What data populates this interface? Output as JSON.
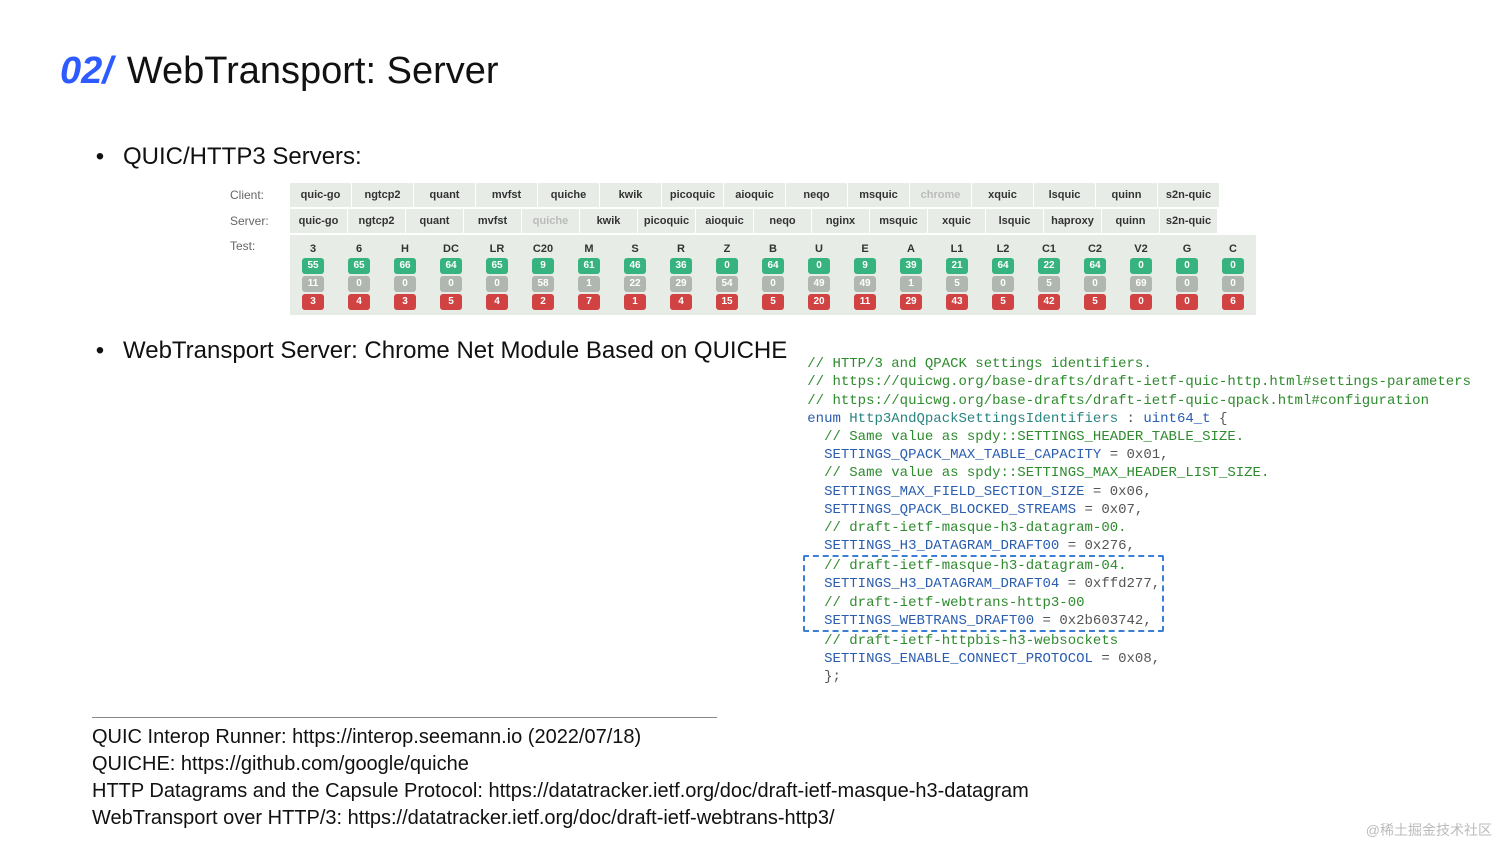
{
  "header": {
    "section_no": "02/",
    "title": "WebTransport: Server"
  },
  "bullet1": "QUIC/HTTP3 Servers:",
  "bullet2": "WebTransport Server: Chrome Net Module Based on QUICHE",
  "interop": {
    "client_label": "Client:",
    "server_label": "Server:",
    "test_label": "Test:",
    "clients": [
      "quic-go",
      "ngtcp2",
      "quant",
      "mvfst",
      "quiche",
      "kwik",
      "picoquic",
      "aioquic",
      "neqo",
      "msquic",
      "chrome",
      "xquic",
      "lsquic",
      "quinn",
      "s2n-quic"
    ],
    "client_dim_index": 10,
    "servers": [
      "quic-go",
      "ngtcp2",
      "quant",
      "mvfst",
      "quiche",
      "kwik",
      "picoquic",
      "aioquic",
      "neqo",
      "nginx",
      "msquic",
      "xquic",
      "lsquic",
      "haproxy",
      "quinn",
      "s2n-quic"
    ],
    "server_dim_index": 4,
    "test_cols": [
      {
        "h": "3",
        "g": "55",
        "m": "11",
        "r": "3"
      },
      {
        "h": "6",
        "g": "65",
        "m": "0",
        "r": "4"
      },
      {
        "h": "H",
        "g": "66",
        "m": "0",
        "r": "3"
      },
      {
        "h": "DC",
        "g": "64",
        "m": "0",
        "r": "5"
      },
      {
        "h": "LR",
        "g": "65",
        "m": "0",
        "r": "4"
      },
      {
        "h": "C20",
        "g": "9",
        "m": "58",
        "r": "2"
      },
      {
        "h": "M",
        "g": "61",
        "m": "1",
        "r": "7"
      },
      {
        "h": "S",
        "g": "46",
        "m": "22",
        "r": "1"
      },
      {
        "h": "R",
        "g": "36",
        "m": "29",
        "r": "4"
      },
      {
        "h": "Z",
        "g": "0",
        "m": "54",
        "r": "15"
      },
      {
        "h": "B",
        "g": "64",
        "m": "0",
        "r": "5"
      },
      {
        "h": "U",
        "g": "0",
        "m": "49",
        "r": "20"
      },
      {
        "h": "E",
        "g": "9",
        "m": "49",
        "r": "11"
      },
      {
        "h": "A",
        "g": "39",
        "m": "1",
        "r": "29"
      },
      {
        "h": "L1",
        "g": "21",
        "m": "5",
        "r": "43"
      },
      {
        "h": "L2",
        "g": "64",
        "m": "0",
        "r": "5"
      },
      {
        "h": "C1",
        "g": "22",
        "m": "5",
        "r": "42"
      },
      {
        "h": "C2",
        "g": "64",
        "m": "0",
        "r": "5"
      },
      {
        "h": "V2",
        "g": "0",
        "m": "69",
        "r": "0"
      },
      {
        "h": "G",
        "g": "0",
        "m": "0",
        "r": "0"
      },
      {
        "h": "C",
        "g": "0",
        "m": "0",
        "r": "6"
      }
    ]
  },
  "code": {
    "l1": "// HTTP/3 and QPACK settings identifiers.",
    "l2": "// https://quicwg.org/base-drafts/draft-ietf-quic-http.html#settings-parameters",
    "l3": "// https://quicwg.org/base-drafts/draft-ietf-quic-qpack.html#configuration",
    "l4a": "enum ",
    "l4b": "Http3AndQpackSettingsIdentifiers",
    "l4c": " : ",
    "l4d": "uint64_t",
    "l4e": " {",
    "l5": "  // Same value as spdy::SETTINGS_HEADER_TABLE_SIZE.",
    "l6a": "  SETTINGS_QPACK_MAX_TABLE_CAPACITY",
    "l6b": " = 0x01,",
    "l7": "  // Same value as spdy::SETTINGS_MAX_HEADER_LIST_SIZE.",
    "l8a": "  SETTINGS_MAX_FIELD_SECTION_SIZE",
    "l8b": " = 0x06,",
    "l9a": "  SETTINGS_QPACK_BLOCKED_STREAMS",
    "l9b": " = 0x07,",
    "l10": "  // draft-ietf-masque-h3-datagram-00.",
    "l11a": "  SETTINGS_H3_DATAGRAM_DRAFT00",
    "l11b": " = 0x276,",
    "l12": "  // draft-ietf-masque-h3-datagram-04.",
    "l13a": "  SETTINGS_H3_DATAGRAM_DRAFT04",
    "l13b": " = 0xffd277,",
    "l14": "  // draft-ietf-webtrans-http3-00",
    "l15a": "  SETTINGS_WEBTRANS_DRAFT00",
    "l15b": " = 0x2b603742,",
    "l16": "  // draft-ietf-httpbis-h3-websockets",
    "l17a": "  SETTINGS_ENABLE_CONNECT_PROTOCOL",
    "l17b": " = 0x08,",
    "l18": "  };"
  },
  "refs": {
    "r1": "QUIC Interop Runner: https://interop.seemann.io (2022/07/18)",
    "r2": "QUICHE: https://github.com/google/quiche",
    "r3": "HTTP Datagrams and the Capsule Protocol: https://datatracker.ietf.org/doc/draft-ietf-masque-h3-datagram",
    "r4": "WebTransport over HTTP/3: https://datatracker.ietf.org/doc/draft-ietf-webtrans-http3/"
  },
  "watermark": "@稀土掘金技术社区"
}
